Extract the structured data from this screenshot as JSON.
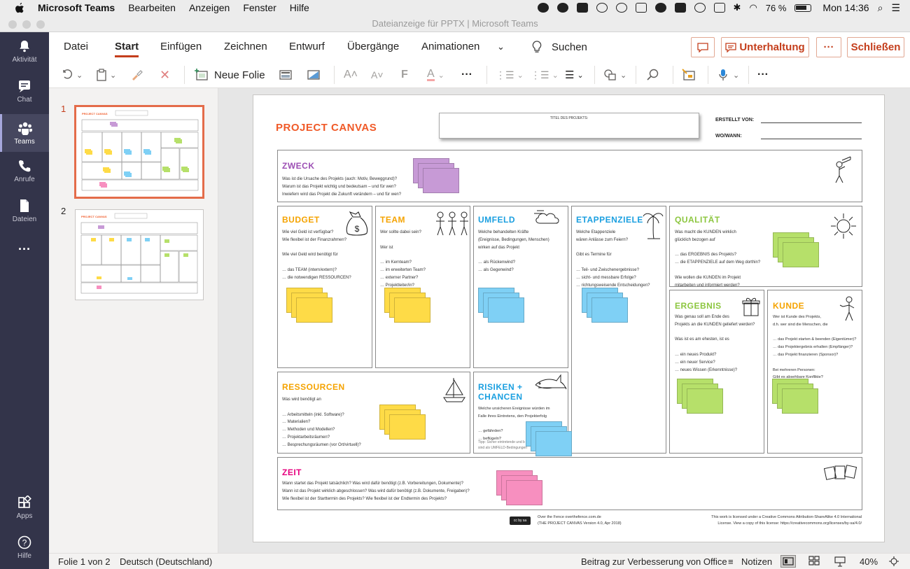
{
  "menubar": {
    "app_name": "Microsoft Teams",
    "items": [
      "Bearbeiten",
      "Anzeigen",
      "Fenster",
      "Hilfe"
    ],
    "battery": "76 %",
    "clock": "Mon 14:36"
  },
  "window": {
    "title": "Dateianzeige für PPTX | Microsoft Teams"
  },
  "rail": {
    "items": [
      {
        "label": "Aktivität",
        "icon": "bell-icon"
      },
      {
        "label": "Chat",
        "icon": "chat-icon"
      },
      {
        "label": "Teams",
        "icon": "teams-icon"
      },
      {
        "label": "Anrufe",
        "icon": "phone-icon"
      },
      {
        "label": "Dateien",
        "icon": "file-icon"
      },
      {
        "label": "Apps",
        "icon": "apps-icon"
      },
      {
        "label": "Hilfe",
        "icon": "help-icon"
      }
    ]
  },
  "ribbon": {
    "tabs": [
      "Datei",
      "Start",
      "Einfügen",
      "Zeichnen",
      "Entwurf",
      "Übergänge",
      "Animationen"
    ],
    "active_tab": "Start",
    "search": "Suchen",
    "conversation": "Unterhaltung",
    "more": "···",
    "close": "Schließen",
    "new_slide": "Neue Folie",
    "accent": "#c43e1c"
  },
  "thumbnails": {
    "numbers": [
      "1",
      "2"
    ]
  },
  "slide": {
    "title": "PROJECT CANVAS",
    "project_title_label": "TITEL DES PROJEKTS:",
    "created_by": "ERSTELLT VON:",
    "where_when": "WO/WANN:",
    "sections": {
      "zweck": {
        "title": "ZWECK",
        "color": "#9c4fb4",
        "text": "Was ist die Ursache des Projekts (auch: Motiv, Beweggrund)?\nWarum ist das Projekt wichtig und bedeutsam – und für wen?\nInwiefern wird das Projekt die Zukunft verändern – und für wen?"
      },
      "budget": {
        "title": "BUDGET",
        "color": "#f5a300",
        "text": "Wie viel Geld ist verfügbar?\nWie flexibel ist der Finanzrahmen?\n\nWie viel Geld wird benötigt für\n\n… das TEAM (intern/extern)?\n… die notwendigen RESSOURCEN?"
      },
      "team": {
        "title": "TEAM",
        "color": "#f5a300",
        "text": "Wer sollte dabei sein?\n\nWer ist\n\n… im Kernteam?\n… im erweiterten Team?\n… externer Partner?\n… Projektleiter/in?"
      },
      "umfeld": {
        "title": "UMFELD",
        "color": "#1a9fe0",
        "text": "Welche behandelten Kräfte\n(Ereignisse, Bedingungen, Menschen)\nwirken auf das Projekt\n\n… als Rückenwind?\n… als Gegenwind?"
      },
      "etappenziele": {
        "title": "ETAPPENZIELE",
        "color": "#1a9fe0",
        "text": "Welche Etappenziele\nwären Anlässe zum Feiern?\n\nGibt es Termine für\n\n… Teil- und Zwischenergebnisse?\n… sicht- und messbare Erfolge?\n… richtungsweisende Entscheidungen?"
      },
      "qualitaet": {
        "title": "QUALITÄT",
        "color": "#8cc63f",
        "text": "Was macht die KUNDEN wirklich\nglücklich bezogen auf\n\n… das ERGEBNIS des Projekts?\n… die ETAPPENZIELE auf dem Weg dorthin?\n\nWie wollen die KUNDEN im Projekt\nmitarbeiten und informiert werden?"
      },
      "ergebnis": {
        "title": "ERGEBNIS",
        "color": "#8cc63f",
        "text": "Was genau soll am Ende des\nProjekts an die KUNDEN geliefert werden?\n\nWas ist es am ehesten, ist es\n\n… ein neues Produkt?\n… ein neuer Service?\n… neues Wissen (Erkenntnisse)?"
      },
      "kunde": {
        "title": "KUNDE",
        "color": "#f5a300",
        "text": "Wer ist Kunde des Projekts,\nd.h. wer sind die Menschen, die\n\n… das Projekt starten & beenden (Eigentümer)?\n… das Projektergebnis erhalten (Empfänger)?\n… das Projekt finanzieren (Sponsor)?\n\nBei mehreren Personen:\nGibt es absehbare Konflikte?"
      },
      "ressourcen": {
        "title": "RESSOURCEN",
        "color": "#f5a300",
        "text": "Was wird benötigt an\n\n… Arbeitsmitteln (inkl. Software)?\n… Materialien?\n… Methoden und Modellen?\n… Projektarbeitsräumen?\n… Besprechungsräumen (vor Ort/virtuell)?"
      },
      "risiken": {
        "title": "RISIKEN +\nCHANCEN",
        "color": "#1a9fe0",
        "text": "Welche unsicheren Ereignisse würden im\nFalle ihres Eintretens, den Projekterfolg\n\n… gefährden?\n… beflügeln?",
        "tip": "Tipp: Sicher eintretende und b\nsind als UMFELD-Bedingungen"
      },
      "zeit": {
        "title": "ZEIT",
        "color": "#e6007e",
        "text": "Wann startet das Projekt tatsächlich? Was wird dafür benötigt (z.B. Vorbereitungen, Dokumente)?\nWann ist das Projekt wirklich abgeschlossen? Was wird dafür benötigt (z.B. Dokumente, Freigaben)?\nWie flexibel ist der Starttermin des Projekts? Wie flexibel ist der Endtermin des Projekts?"
      }
    },
    "footer": {
      "left": "Over the Fence overthefence.com.de\n(THE PROJECT CANVAS Version 4.0, Apr 2018)",
      "right": "This work is licensed under a Creative Commons Attribution-ShareAlike 4.0 International\nLicense. View a copy of this license: https://creativecommons.org/licenses/by-sa/4.0/",
      "cc": "cc by sa"
    },
    "stickies": {
      "purple": "#c79ad6",
      "yellow": "#fedb47",
      "blue": "#7fd0f5",
      "green": "#b6e06a",
      "pink": "#f78fbf"
    }
  },
  "status": {
    "slide_of": "Folie 1 von 2",
    "language": "Deutsch (Deutschland)",
    "feedback": "Beitrag zur Verbesserung von Office",
    "notes": "Notizen",
    "zoom": "40%"
  }
}
